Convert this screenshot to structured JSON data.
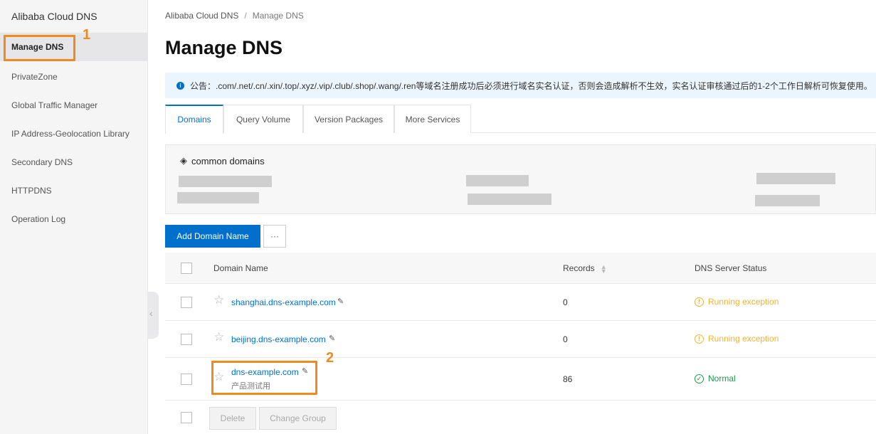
{
  "sidebar": {
    "title": "Alibaba Cloud DNS",
    "items": [
      {
        "label": "Manage DNS"
      },
      {
        "label": "PrivateZone"
      },
      {
        "label": "Global Traffic Manager"
      },
      {
        "label": "IP Address-Geolocation Library"
      },
      {
        "label": "Secondary DNS"
      },
      {
        "label": "HTTPDNS"
      },
      {
        "label": "Operation Log"
      }
    ]
  },
  "callouts": {
    "one": "1",
    "two": "2"
  },
  "breadcrumb": {
    "root": "Alibaba Cloud DNS",
    "separator": "/",
    "current": "Manage DNS"
  },
  "page_title": "Manage DNS",
  "notice": {
    "icon": "info-icon",
    "text": "公告：.com/.net/.cn/.xin/.top/.xyz/.vip/.club/.shop/.wang/.ren等域名注册成功后必须进行域名实名认证，否则会造成解析不生效，实名认证审核通过后的1-2个工作日解析可恢复使用。"
  },
  "tabs": [
    {
      "label": "Domains",
      "active": true
    },
    {
      "label": "Query Volume"
    },
    {
      "label": "Version Packages"
    },
    {
      "label": "More Services"
    }
  ],
  "common_domains": {
    "title": "common domains",
    "icon": "tag-icon"
  },
  "toolbar": {
    "add_label": "Add Domain Name",
    "more_label": "···"
  },
  "table": {
    "headers": {
      "domain": "Domain Name",
      "records": "Records",
      "status": "DNS Server Status"
    },
    "rows": [
      {
        "domain": "shanghai.dns-example.com",
        "records": "0",
        "status": "Running exception",
        "status_type": "warn",
        "remark": ""
      },
      {
        "domain": "beijing.dns-example.com",
        "records": "0",
        "status": "Running exception",
        "status_type": "warn",
        "remark": ""
      },
      {
        "domain": "dns-example.com",
        "records": "86",
        "status": "Normal",
        "status_type": "ok",
        "remark": "产品测试用"
      }
    ]
  },
  "footer": {
    "delete_label": "Delete",
    "change_group_label": "Change Group"
  },
  "colors": {
    "accent": "#0070cc",
    "highlight": "#f18a1c",
    "warn": "#f5b335",
    "ok": "#1a9b4a"
  }
}
